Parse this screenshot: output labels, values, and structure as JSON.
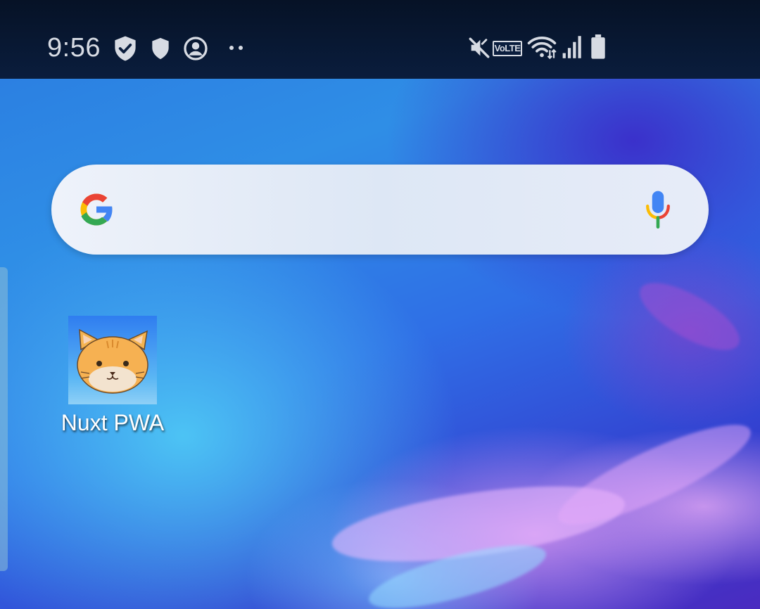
{
  "status_bar": {
    "time": "9:56",
    "left_icons": [
      "shield-check-icon",
      "shield-icon",
      "account-circle-icon",
      "more-dots-icon"
    ],
    "right_icons": [
      "mute-icon",
      "volte-icon",
      "wifi-icon",
      "signal-icon",
      "battery-icon"
    ],
    "volte_label": "VoLTE"
  },
  "search_widget": {
    "logo": "google-g-icon",
    "voice": "mic-icon"
  },
  "apps": [
    {
      "label": "Nuxt PWA",
      "icon": "cat-face-icon"
    }
  ],
  "colors": {
    "status_bar_bg": "#061226",
    "search_bar_bg": "#e6ecf8",
    "google_blue": "#4285F4",
    "google_red": "#EA4335",
    "google_yellow": "#FBBC05",
    "google_green": "#34A853",
    "label_text": "#ffffff"
  }
}
